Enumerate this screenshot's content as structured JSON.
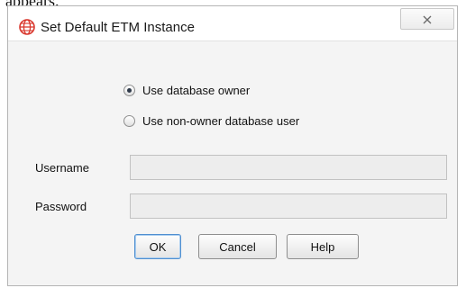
{
  "page": {
    "caption": "appears."
  },
  "dialog": {
    "title": "Set Default ETM Instance",
    "icon": "globe-icon",
    "close_icon": "close-icon"
  },
  "options": {
    "items": [
      {
        "label": "Use database owner",
        "selected": true
      },
      {
        "label": "Use non-owner database user",
        "selected": false
      }
    ]
  },
  "fields": {
    "username": {
      "label": "Username",
      "value": ""
    },
    "password": {
      "label": "Password",
      "value": ""
    }
  },
  "buttons": {
    "ok": "OK",
    "cancel": "Cancel",
    "help": "Help"
  },
  "colors": {
    "icon_red": "#d9382e",
    "default_button_border": "#4f8fd0"
  }
}
